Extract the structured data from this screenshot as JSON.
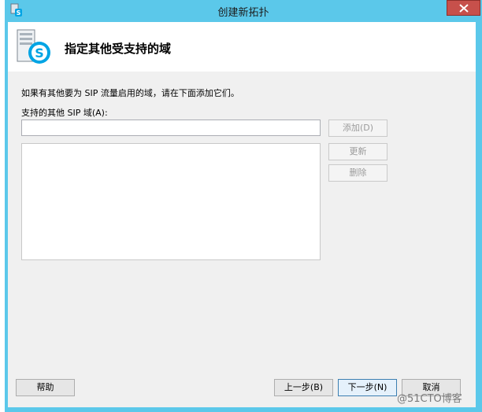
{
  "window": {
    "title": "创建新拓扑",
    "accent_color": "#5bc8ea",
    "close_icon": "close-icon",
    "app_icon": "topology-builder-icon"
  },
  "header": {
    "title": "指定其他受支持的域",
    "icon": "skype-server-icon"
  },
  "content": {
    "description": "如果有其他要为 SIP 流量启用的域，请在下面添加它们。",
    "field_label": "支持的其他 SIP 域(A):",
    "domain_input_value": "",
    "domains_list": []
  },
  "side_buttons": {
    "add": "添加(D)",
    "update": "更新",
    "delete": "删除"
  },
  "footer": {
    "help": "帮助",
    "back": "上一步(B)",
    "next": "下一步(N)",
    "cancel": "取消"
  },
  "watermark": "@51CTO博客"
}
